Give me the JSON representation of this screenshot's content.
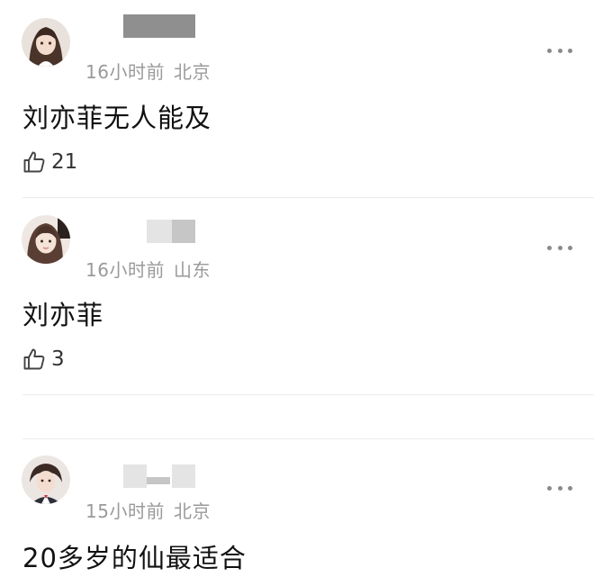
{
  "comments": [
    {
      "time": "16小时前",
      "location": "北京",
      "text": "刘亦菲无人能及",
      "likes": "21",
      "avatar_icon": "user-avatar-icon"
    },
    {
      "time": "16小时前",
      "location": "山东",
      "text": "刘亦菲",
      "likes": "3",
      "avatar_icon": "user-avatar-icon"
    },
    {
      "time": "15小时前",
      "location": "北京",
      "text": "20多岁的仙最适合",
      "likes": "",
      "avatar_icon": "user-avatar-icon"
    }
  ],
  "icons": {
    "like": "thumbs-up-icon",
    "more": "more-options-icon"
  },
  "colors": {
    "meta_text": "#9a9a9a",
    "content_text": "#111111",
    "divider": "#ececec"
  }
}
